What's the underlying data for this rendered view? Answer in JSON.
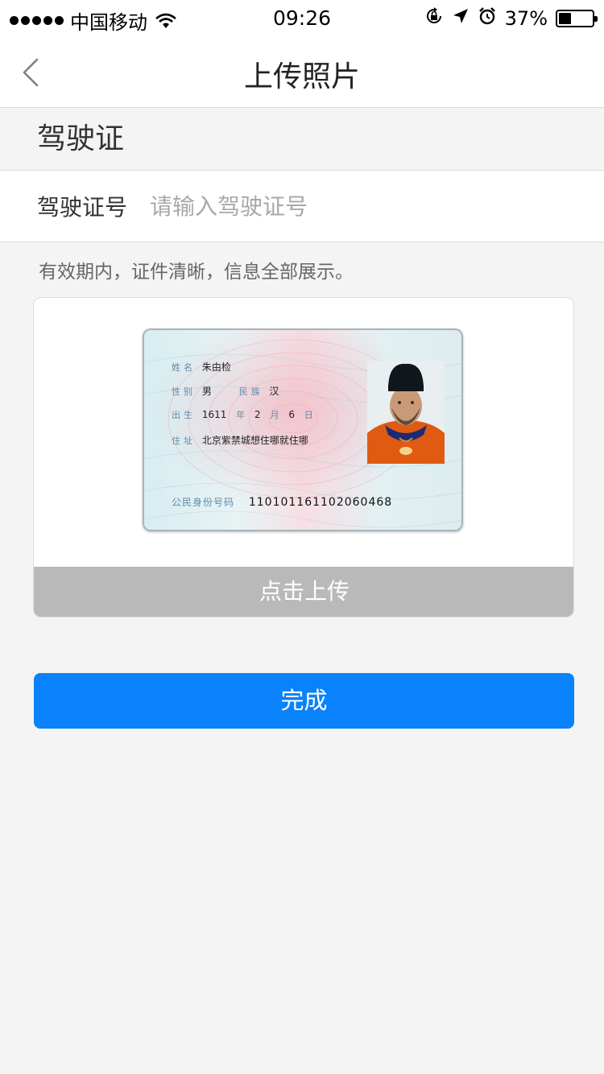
{
  "status_bar": {
    "carrier": "中国移动",
    "time": "09:26",
    "battery_percent_text": "37%",
    "battery_level": 0.37
  },
  "nav": {
    "title": "上传照片",
    "back_icon": "chevron-left-icon"
  },
  "section": {
    "title": "驾驶证"
  },
  "form": {
    "license_label": "驾驶证号",
    "license_placeholder": "请输入驾驶证号",
    "license_value": ""
  },
  "hint": "有效期内，证件清晰，信息全部展示。",
  "sample_card": {
    "name_key": "姓名",
    "name": "朱由检",
    "gender_key": "性别",
    "gender": "男",
    "ethnicity_key": "民族",
    "ethnicity": "汉",
    "birth_key": "出生",
    "birth_year": "1611",
    "year_unit": "年",
    "birth_month": "2",
    "month_unit": "月",
    "birth_day": "6",
    "day_unit": "日",
    "address_key": "住址",
    "address": "北京紫禁城想住哪就住哪",
    "id_number_key": "公民身份号码",
    "id_number": "110101161102060468"
  },
  "upload_label": "点击上传",
  "done_label": "完成",
  "colors": {
    "primary": "#0a82fb",
    "upload_bar": "#b9b9b9",
    "background": "#f4f4f4"
  }
}
